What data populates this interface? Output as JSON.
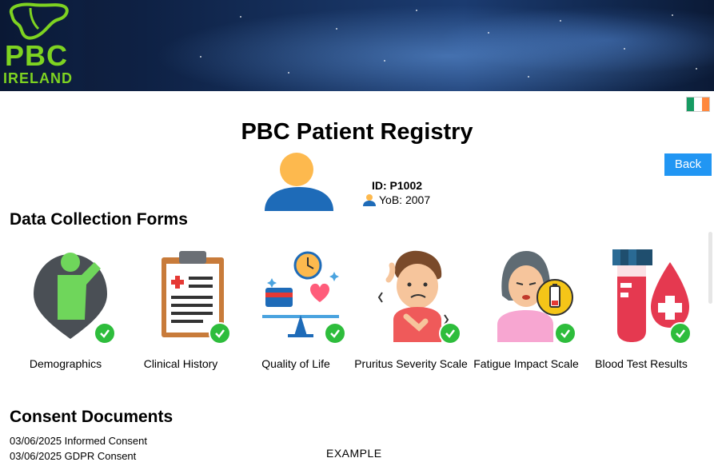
{
  "header": {
    "logo_line1": "PBC",
    "logo_line2": "IRELAND",
    "language_flag": "ireland-flag-icon",
    "flag_colors": [
      "#169b62",
      "#ffffff",
      "#ff883e"
    ]
  },
  "page": {
    "title": "PBC Patient Registry"
  },
  "patient": {
    "id_label": "ID: P1002",
    "yob_label": "YoB: 2007",
    "avatar_icon": "user-avatar-icon"
  },
  "actions": {
    "back_label": "Back"
  },
  "data_collection": {
    "heading": "Data Collection Forms",
    "forms": [
      {
        "label": "Demographics",
        "icon": "person-location-icon",
        "completed": true
      },
      {
        "label": "Clinical History",
        "icon": "medical-clipboard-icon",
        "completed": true
      },
      {
        "label": "Quality of Life",
        "icon": "balance-scale-icon",
        "completed": true
      },
      {
        "label": "Pruritus Severity Scale",
        "icon": "itching-person-icon",
        "completed": true
      },
      {
        "label": "Fatigue Impact Scale",
        "icon": "tired-person-battery-icon",
        "completed": true
      },
      {
        "label": "Blood Test Results",
        "icon": "blood-test-icon",
        "completed": true
      }
    ]
  },
  "consent": {
    "heading": "Consent Documents",
    "documents": [
      {
        "label": "03/06/2025 Informed Consent"
      },
      {
        "label": "03/06/2025 GDPR Consent"
      }
    ]
  },
  "watermark": "EXAMPLE",
  "colors": {
    "accent_green": "#7ed321",
    "check_green": "#2ebd3c",
    "button_blue": "#2196f3"
  }
}
